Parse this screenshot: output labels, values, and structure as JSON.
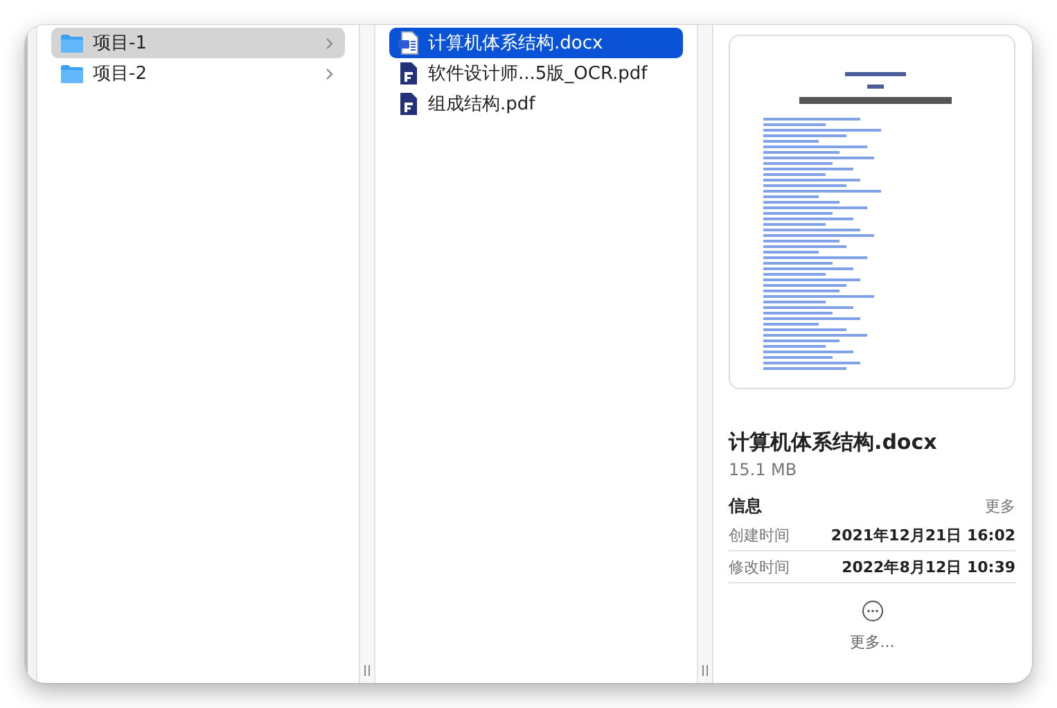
{
  "columns": [
    {
      "active": false,
      "items": [
        {
          "name": "项目-1",
          "kind": "folder",
          "selected": true
        },
        {
          "name": "项目-2",
          "kind": "folder",
          "selected": false
        }
      ]
    },
    {
      "active": true,
      "items": [
        {
          "name": "计算机体系结构.docx",
          "kind": "word",
          "selected": true
        },
        {
          "name": "软件设计师...5版_OCR.pdf",
          "kind": "pdf",
          "selected": false
        },
        {
          "name": "组成结构.pdf",
          "kind": "pdf",
          "selected": false
        }
      ]
    }
  ],
  "preview": {
    "file_name": "计算机体系结构.docx",
    "size": "15.1 MB",
    "info_title": "信息",
    "info_more": "更多",
    "rows": [
      {
        "label": "创建时间",
        "value": "2021年12月21日 16:02"
      },
      {
        "label": "修改时间",
        "value": "2022年8月12日 10:39"
      }
    ],
    "more_button": "更多..."
  }
}
